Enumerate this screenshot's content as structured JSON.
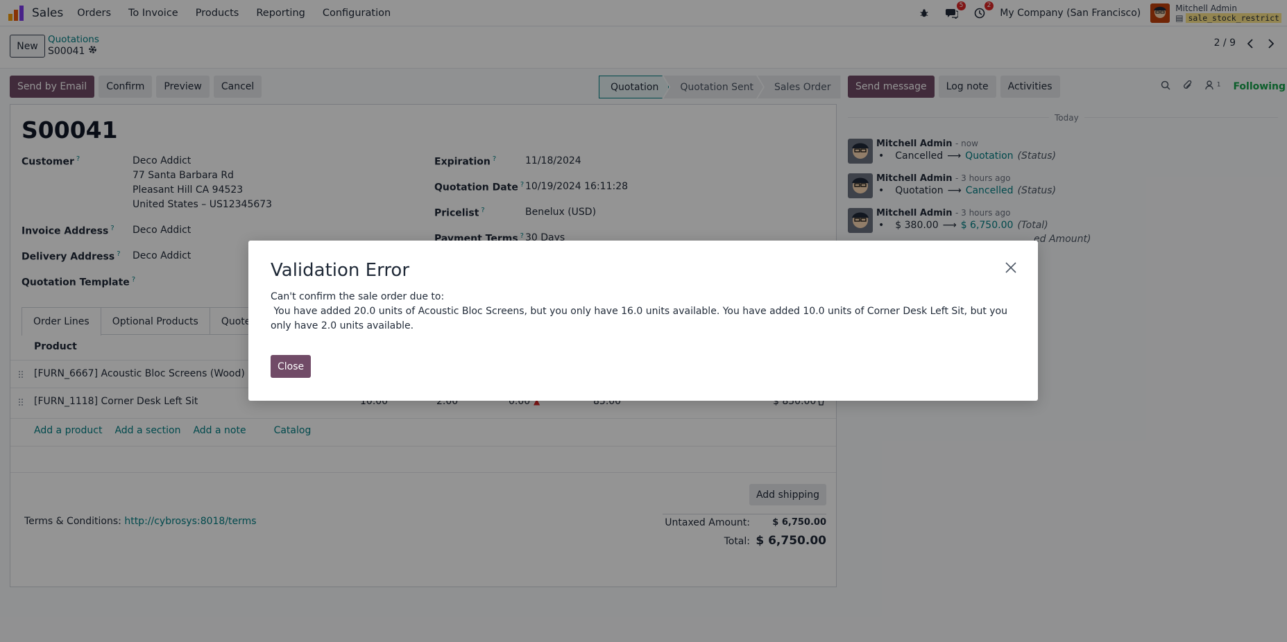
{
  "colors": {
    "primary": "#714b67",
    "accent": "#017e84",
    "following": "#16a34a",
    "badge": "#dc2626"
  },
  "navbar": {
    "app_name": "Sales",
    "menu": [
      "Orders",
      "To Invoice",
      "Products",
      "Reporting",
      "Configuration"
    ],
    "messages_badge": "5",
    "activities_badge": "2",
    "company": "My Company (San Francisco)",
    "user_name": "Mitchell Admin",
    "db_name": "sale_stock_restrict"
  },
  "control": {
    "new_label": "New",
    "breadcrumb_parent": "Quotations",
    "breadcrumb_current": "S00041",
    "pager": "2 / 9"
  },
  "actions": [
    "Send by Email",
    "Confirm",
    "Preview",
    "Cancel"
  ],
  "statusbar": [
    "Quotation",
    "Quotation Sent",
    "Sales Order"
  ],
  "form": {
    "title": "S00041",
    "customer_label": "Customer",
    "customer_name": "Deco Addict",
    "customer_street": "77 Santa Barbara Rd",
    "customer_city": "Pleasant Hill CA 94523",
    "customer_country": "United States – US12345673",
    "invoice_label": "Invoice Address",
    "invoice_value": "Deco Addict",
    "delivery_label": "Delivery Address",
    "delivery_value": "Deco Addict",
    "template_label": "Quotation Template",
    "expiration_label": "Expiration",
    "expiration_value": "11/18/2024",
    "qdate_label": "Quotation Date",
    "qdate_value": "10/19/2024 16:11:28",
    "pricelist_label": "Pricelist",
    "pricelist_value": "Benelux (USD)",
    "payterms_label": "Payment Terms",
    "payterms_value": "30 Days",
    "help_mark": "?"
  },
  "tabs": [
    "Order Lines",
    "Optional Products",
    "Quote B"
  ],
  "lines": {
    "header_product": "Product",
    "rows": [
      {
        "product": "[FURN_6667] Acoustic Bloc Screens (Wood)"
      },
      {
        "product": "[FURN_1118] Corner Desk Left Sit",
        "qty": "10.00",
        "delivered": "2.00",
        "discount": "0.00",
        "price": "85.00",
        "subtotal": "$ 850.00"
      }
    ],
    "add_product": "Add a product",
    "add_section": "Add a section",
    "add_note": "Add a note",
    "catalog": "Catalog"
  },
  "footer": {
    "add_shipping": "Add shipping",
    "terms_label": "Terms & Conditions:",
    "terms_link": "http://cybrosys:8018/terms",
    "untaxed_label": "Untaxed Amount:",
    "untaxed_value": "$ 6,750.00",
    "total_label": "Total:",
    "total_value": "$ 6,750.00"
  },
  "chatter": {
    "send_message": "Send message",
    "log_note": "Log note",
    "activities": "Activities",
    "followers_count": "1",
    "following": "Following",
    "today": "Today",
    "messages": [
      {
        "author": "Mitchell Admin",
        "time": "- now",
        "old": "Cancelled",
        "new": "Quotation",
        "field": "(Status)"
      },
      {
        "author": "Mitchell Admin",
        "time": "- 3 hours ago",
        "old": "Quotation",
        "new": "Cancelled",
        "field": "(Status)"
      },
      {
        "author": "Mitchell Admin",
        "time": "- 3 hours ago",
        "old": "$ 380.00",
        "new": "$ 6,750.00",
        "field": "(Total)"
      }
    ],
    "partial_line": "ed Amount)"
  },
  "dialog": {
    "title": "Validation Error",
    "body": "Can't confirm the sale order due to:\n You have added 20.0 units of Acoustic Bloc Screens, but you only have 16.0 units available. You have added 10.0 units of Corner Desk Left Sit, but you only have 2.0 units available.",
    "close_label": "Close"
  }
}
